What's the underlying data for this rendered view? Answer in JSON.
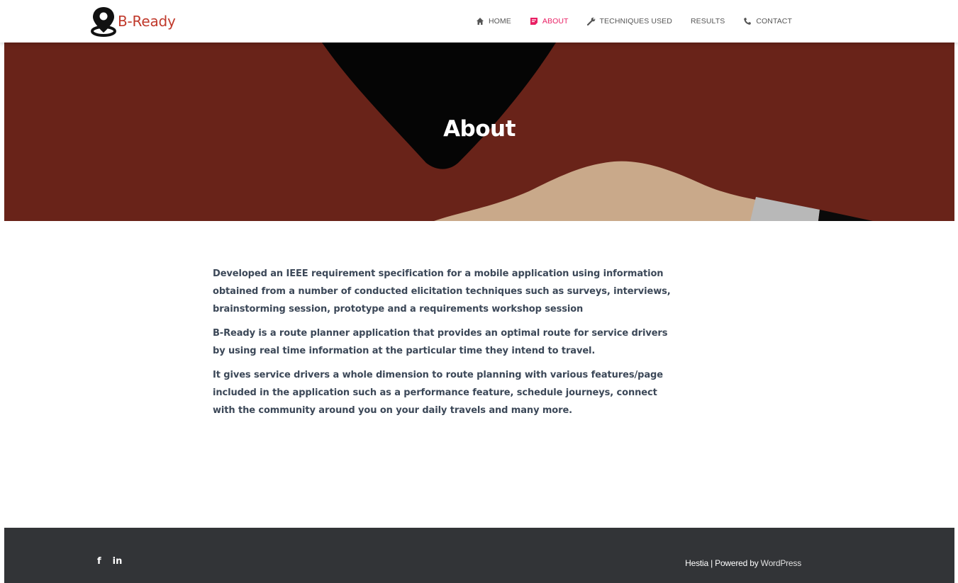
{
  "brand": {
    "name": "B-Ready",
    "icon": "map-pin-icon",
    "color": "#c0392b"
  },
  "nav": {
    "items": [
      {
        "label": "Home",
        "icon": "home-icon",
        "active": false
      },
      {
        "label": "About",
        "icon": "note-icon",
        "active": true
      },
      {
        "label": "Techniques Used",
        "icon": "wrench-icon",
        "active": false
      },
      {
        "label": "Results",
        "icon": "",
        "active": false
      },
      {
        "label": "Contact",
        "icon": "phone-icon",
        "active": false
      }
    ],
    "active_color": "#e91e63"
  },
  "hero": {
    "title": "About",
    "background_color": "#692319"
  },
  "content": {
    "paragraphs": [
      "Developed an IEEE requirement specification for a mobile application using information obtained from a number of conducted elicitation techniques such as surveys, interviews, brainstorming session, prototype and a requirements workshop session",
      "B-Ready is a route planner application that provides an optimal route for service drivers by using real time information at the particular time they intend to travel.",
      "It gives service drivers a whole dimension to route planning with various features/page included in the application such as a performance feature, schedule journeys, connect with the community around you on your daily travels and many more."
    ]
  },
  "footer": {
    "social": [
      {
        "label": "f",
        "icon": "facebook-icon"
      },
      {
        "label": "in",
        "icon": "linkedin-icon"
      }
    ],
    "copyright_theme": "Hestia",
    "copyright_sep": " | Powered by ",
    "copyright_link": "WordPress",
    "background_color": "#323437"
  }
}
